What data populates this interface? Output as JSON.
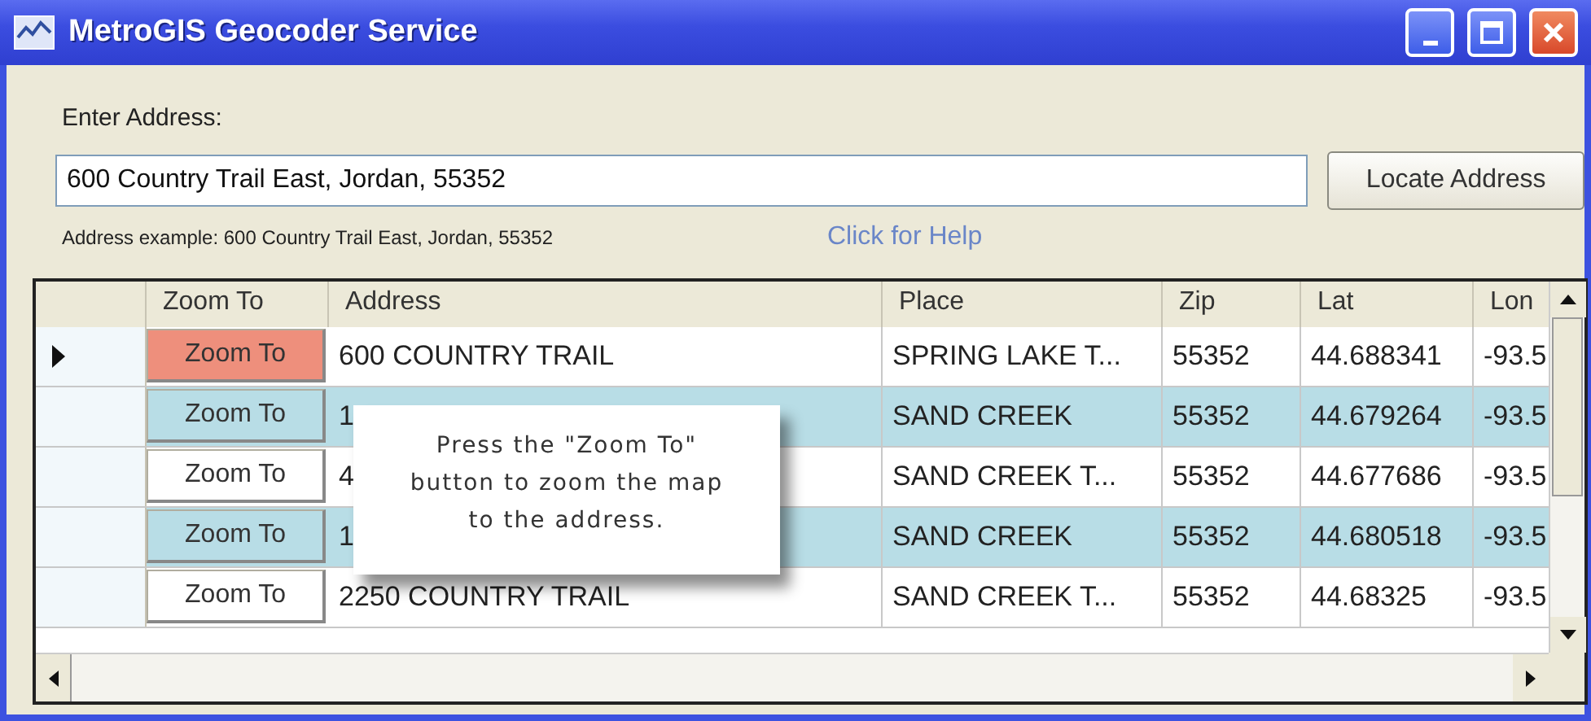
{
  "window": {
    "title": "MetroGIS Geocoder Service"
  },
  "address_label": "Enter Address:",
  "address_field": {
    "value": "600 Country Trail East, Jordan, 55352"
  },
  "locate_button": "Locate Address",
  "example": "Address example: 600 Country Trail East, Jordan, 55352",
  "help_link": "Click for Help",
  "table": {
    "columns": [
      "Zoom To",
      "Address",
      "Place",
      "Zip",
      "Lat",
      "Lon"
    ],
    "rows": [
      {
        "selected": true,
        "zoom": "Zoom To",
        "address": "600 COUNTRY TRAIL",
        "place": "SPRING LAKE T...",
        "zip": "55352",
        "lat": "44.688341",
        "long": "-93.5"
      },
      {
        "selected": false,
        "zoom": "Zoom To",
        "address": "1",
        "place": "SAND CREEK",
        "zip": "55352",
        "lat": "44.679264",
        "long": "-93.5"
      },
      {
        "selected": false,
        "zoom": "Zoom To",
        "address": "4",
        "place": "SAND CREEK T...",
        "zip": "55352",
        "lat": "44.677686",
        "long": "-93.5"
      },
      {
        "selected": false,
        "zoom": "Zoom To",
        "address": "1",
        "place": "SAND CREEK",
        "zip": "55352",
        "lat": "44.680518",
        "long": "-93.5"
      },
      {
        "selected": false,
        "zoom": "Zoom To",
        "address": "2250 COUNTRY TRAIL",
        "place": "SAND CREEK T...",
        "zip": "55352",
        "lat": "44.68325",
        "long": "-93.5"
      }
    ]
  },
  "tooltip": "Press the \"Zoom To\" button to zoom the map to the address."
}
